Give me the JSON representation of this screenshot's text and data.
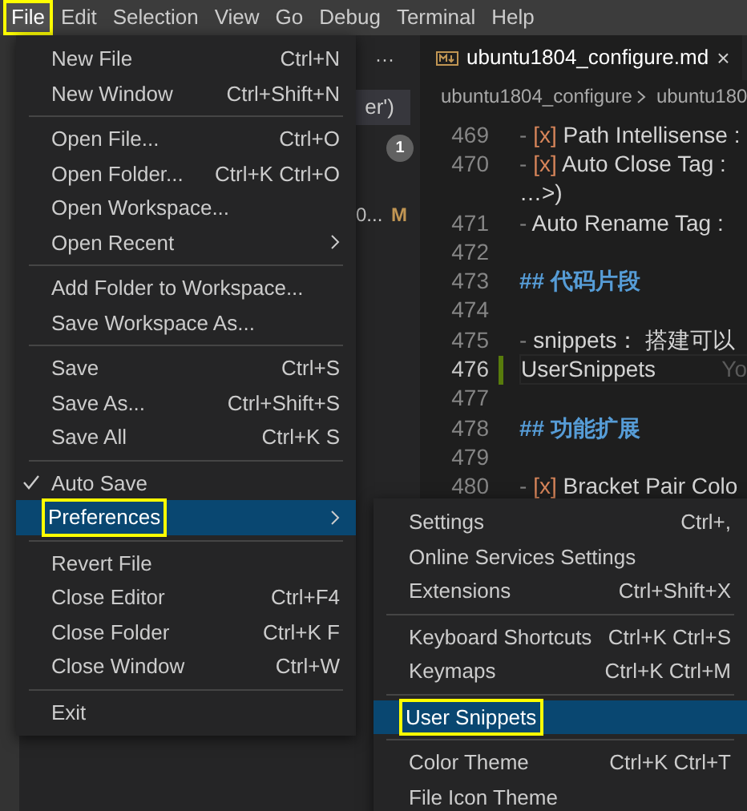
{
  "menu_bar": [
    {
      "label": "File",
      "selected": true,
      "annotated": true
    },
    {
      "label": "Edit",
      "selected": false,
      "annotated": false
    },
    {
      "label": "Selection",
      "selected": false,
      "annotated": false
    },
    {
      "label": "View",
      "selected": false,
      "annotated": false
    },
    {
      "label": "Go",
      "selected": false,
      "annotated": false
    },
    {
      "label": "Debug",
      "selected": false,
      "annotated": false
    },
    {
      "label": "Terminal",
      "selected": false,
      "annotated": false
    },
    {
      "label": "Help",
      "selected": false,
      "annotated": false
    }
  ],
  "explorer": {
    "more": "···",
    "item_text": "er')",
    "badge": "1",
    "file_text": "0...",
    "file_status": "M"
  },
  "editor": {
    "tab": {
      "title": "ubuntu1804_configure.md",
      "close": "×"
    },
    "breadcrumb": [
      "ubuntu1804_configure",
      "ubuntu180"
    ],
    "lines": [
      {
        "number": "469",
        "current": false,
        "modified": false,
        "segments": [
          {
            "kind": "dash",
            "text": "- "
          },
          {
            "kind": "box",
            "text": "[x]"
          },
          {
            "kind": "plain",
            "text": " Path Intellisense :"
          }
        ]
      },
      {
        "number": "470",
        "current": false,
        "modified": false,
        "segments": [
          {
            "kind": "dash",
            "text": "- "
          },
          {
            "kind": "box",
            "text": "[x]"
          },
          {
            "kind": "plain",
            "text": " Auto Close Tag :"
          }
        ]
      },
      {
        "current": false,
        "modified": false,
        "segments": [
          {
            "kind": "plain",
            "text": "…>)"
          }
        ]
      },
      {
        "number": "471",
        "current": false,
        "modified": false,
        "segments": [
          {
            "kind": "dash",
            "text": "- "
          },
          {
            "kind": "plain",
            "text": "Auto Rename Tag :"
          }
        ]
      },
      {
        "number": "472",
        "current": false,
        "modified": false
      },
      {
        "number": "473",
        "current": false,
        "modified": false,
        "segments": [
          {
            "kind": "heading",
            "text": "## 代码片段"
          }
        ]
      },
      {
        "number": "474",
        "current": false,
        "modified": false
      },
      {
        "number": "475",
        "current": false,
        "modified": false,
        "segments": [
          {
            "kind": "dash",
            "text": "- "
          },
          {
            "kind": "plain",
            "text": "snippets： 搭建可以"
          }
        ]
      },
      {
        "number": "476",
        "current": true,
        "modified": true,
        "segments": [
          {
            "kind": "plain",
            "text": "UserSnippets"
          }
        ],
        "ghost": "Yo"
      },
      {
        "number": "477",
        "current": false,
        "modified": false
      },
      {
        "number": "478",
        "current": false,
        "modified": false,
        "segments": [
          {
            "kind": "heading",
            "text": "## 功能扩展"
          }
        ]
      },
      {
        "number": "479",
        "current": false,
        "modified": false
      },
      {
        "number": "480",
        "current": false,
        "modified": false,
        "segments": [
          {
            "kind": "dash",
            "text": "- "
          },
          {
            "kind": "box",
            "text": "[x]"
          },
          {
            "kind": "plain",
            "text": " Bracket Pair Colo"
          }
        ]
      }
    ]
  },
  "file_menu": [
    {
      "kind": "item",
      "label": "New File",
      "shortcut": "Ctrl+N",
      "checked": false,
      "submenu": false,
      "selected": false,
      "annotated": false
    },
    {
      "kind": "item",
      "label": "New Window",
      "shortcut": "Ctrl+Shift+N",
      "checked": false,
      "submenu": false,
      "selected": false,
      "annotated": false
    },
    {
      "kind": "separator"
    },
    {
      "kind": "item",
      "label": "Open File...",
      "shortcut": "Ctrl+O",
      "checked": false,
      "submenu": false,
      "selected": false,
      "annotated": false
    },
    {
      "kind": "item",
      "label": "Open Folder...",
      "shortcut": "Ctrl+K Ctrl+O",
      "checked": false,
      "submenu": false,
      "selected": false,
      "annotated": false
    },
    {
      "kind": "item",
      "label": "Open Workspace...",
      "checked": false,
      "submenu": false,
      "selected": false,
      "annotated": false
    },
    {
      "kind": "item",
      "label": "Open Recent",
      "checked": false,
      "submenu": true,
      "selected": false,
      "annotated": false
    },
    {
      "kind": "separator"
    },
    {
      "kind": "item",
      "label": "Add Folder to Workspace...",
      "checked": false,
      "submenu": false,
      "selected": false,
      "annotated": false
    },
    {
      "kind": "item",
      "label": "Save Workspace As...",
      "checked": false,
      "submenu": false,
      "selected": false,
      "annotated": false
    },
    {
      "kind": "separator"
    },
    {
      "kind": "item",
      "label": "Save",
      "shortcut": "Ctrl+S",
      "checked": false,
      "submenu": false,
      "selected": false,
      "annotated": false
    },
    {
      "kind": "item",
      "label": "Save As...",
      "shortcut": "Ctrl+Shift+S",
      "checked": false,
      "submenu": false,
      "selected": false,
      "annotated": false
    },
    {
      "kind": "item",
      "label": "Save All",
      "shortcut": "Ctrl+K S",
      "checked": false,
      "submenu": false,
      "selected": false,
      "annotated": false
    },
    {
      "kind": "separator"
    },
    {
      "kind": "item",
      "label": "Auto Save",
      "checked": true,
      "submenu": false,
      "selected": false,
      "annotated": false
    },
    {
      "kind": "item",
      "label": "Preferences",
      "checked": false,
      "submenu": true,
      "selected": true,
      "annotated": true
    },
    {
      "kind": "separator"
    },
    {
      "kind": "item",
      "label": "Revert File",
      "checked": false,
      "submenu": false,
      "selected": false,
      "annotated": false
    },
    {
      "kind": "item",
      "label": "Close Editor",
      "shortcut": "Ctrl+F4",
      "checked": false,
      "submenu": false,
      "selected": false,
      "annotated": false
    },
    {
      "kind": "item",
      "label": "Close Folder",
      "shortcut": "Ctrl+K F",
      "checked": false,
      "submenu": false,
      "selected": false,
      "annotated": false
    },
    {
      "kind": "item",
      "label": "Close Window",
      "shortcut": "Ctrl+W",
      "checked": false,
      "submenu": false,
      "selected": false,
      "annotated": false
    },
    {
      "kind": "separator"
    },
    {
      "kind": "item",
      "label": "Exit",
      "checked": false,
      "submenu": false,
      "selected": false,
      "annotated": false
    }
  ],
  "preferences_menu": [
    {
      "kind": "item",
      "label": "Settings",
      "shortcut": "Ctrl+,",
      "selected": false,
      "annotated": false
    },
    {
      "kind": "item",
      "label": "Online Services Settings",
      "selected": false,
      "annotated": false
    },
    {
      "kind": "item",
      "label": "Extensions",
      "shortcut": "Ctrl+Shift+X",
      "selected": false,
      "annotated": false
    },
    {
      "kind": "separator"
    },
    {
      "kind": "item",
      "label": "Keyboard Shortcuts",
      "shortcut": "Ctrl+K Ctrl+S",
      "selected": false,
      "annotated": false
    },
    {
      "kind": "item",
      "label": "Keymaps",
      "shortcut": "Ctrl+K Ctrl+M",
      "selected": false,
      "annotated": false
    },
    {
      "kind": "separator"
    },
    {
      "kind": "item",
      "label": "User Snippets",
      "selected": true,
      "annotated": true
    },
    {
      "kind": "separator"
    },
    {
      "kind": "item",
      "label": "Color Theme",
      "shortcut": "Ctrl+K Ctrl+T",
      "selected": false,
      "annotated": false
    },
    {
      "kind": "item",
      "label": "File Icon Theme",
      "selected": false,
      "annotated": false
    }
  ]
}
